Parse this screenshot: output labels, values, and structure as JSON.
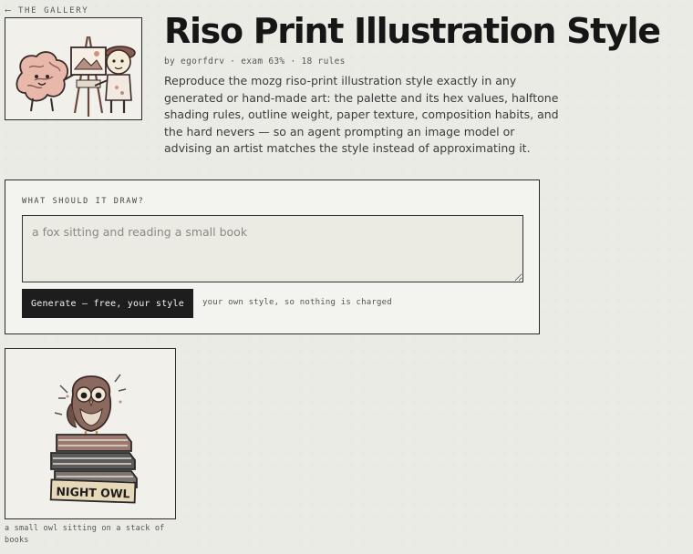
{
  "nav": {
    "back_label": "⟵ THE GALLERY"
  },
  "header": {
    "title": "Riso Print Illustration Style",
    "meta": "by egorfdrv · exam 63% · 18 rules",
    "description": "Reproduce the mozg riso-print illustration style exactly in any generated or hand-made art: the palette and its hex values, halftone shading rules, outline weight, paper texture, composition habits, and the hard nevers — so an agent prompting an image model or advising an artist matches the style instead of approximating it."
  },
  "prompt_form": {
    "label": "WHAT SHOULD IT DRAW?",
    "placeholder": "a fox sitting and reading a small book",
    "value": "",
    "button_label": "Generate — free, your style",
    "note": "your own style, so nothing is charged"
  },
  "gallery": [
    {
      "caption": "a small owl sitting on a stack of books",
      "sign_text": "NIGHT OWL",
      "icon": "owl-on-books-illustration"
    }
  ],
  "hero_image": {
    "icon": "brain-and-painter-illustration"
  },
  "colors": {
    "background": "#ebebe6",
    "ink": "#1d1d1d",
    "card": "#f3f3ef",
    "brown": "#8a6a5e",
    "blush": "#e5b6a8"
  }
}
